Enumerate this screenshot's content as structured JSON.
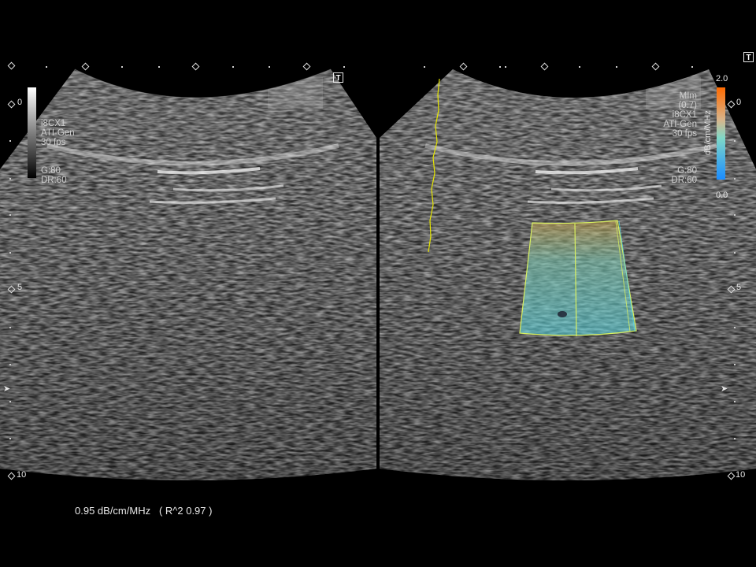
{
  "left_pane": {
    "probe": "i8CX1",
    "mode": "ATI-Gen",
    "frame_rate": "30 fps",
    "gain": "G:80",
    "dynamic_range": "DR:60",
    "depth_top": "0",
    "depth_mid": "5",
    "depth_bottom": "10"
  },
  "right_pane": {
    "marker_line1": "MIm",
    "marker_line2": "(0.7)",
    "probe": "i8CX1",
    "mode": "ATI-Gen",
    "frame_rate": "30 fps",
    "gain": "G:80",
    "dynamic_range": "DR:60",
    "depth_top": "0",
    "depth_mid": "5",
    "depth_bottom": "10"
  },
  "colorbar": {
    "max": "2.0",
    "min": "0.0",
    "unit": "dB/cm/MHz",
    "colors": {
      "top": "#ff6a00",
      "mid": "#7fd8c8",
      "bottom": "#1a8cff"
    }
  },
  "t_marker": "T",
  "result": {
    "value": "0.95 dB/cm/MHz",
    "r2": "( R^2 0.97 )"
  },
  "colors": {
    "roi_fill": "#5fd6d0",
    "roi_border": "#d8f060",
    "trace": "#e6e600"
  }
}
